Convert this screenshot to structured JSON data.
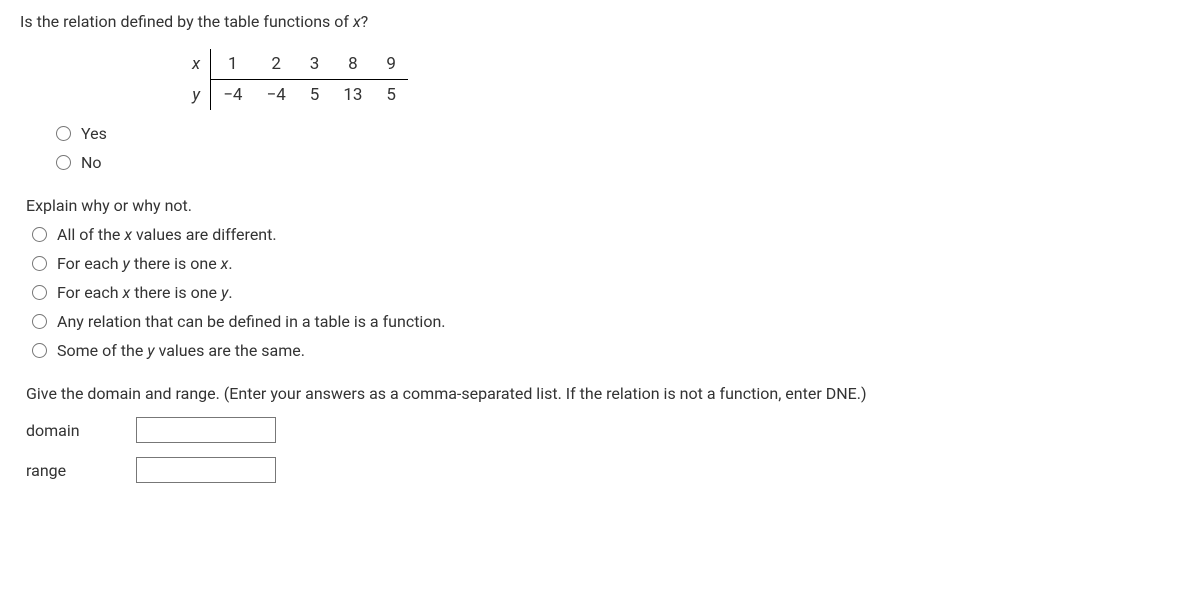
{
  "question": {
    "prefix": "Is the relation defined by the table functions of ",
    "var": "x",
    "suffix": "?"
  },
  "table": {
    "x_label": "x",
    "y_label": "y",
    "x_values": [
      "1",
      "2",
      "3",
      "8",
      "9"
    ],
    "y_values": [
      "−4",
      "−4",
      "5",
      "13",
      "5"
    ]
  },
  "options_yesno": {
    "yes": "Yes",
    "no": "No"
  },
  "explain_label": "Explain why or why not.",
  "options_explain": {
    "o1_pre": "All of the ",
    "o1_var": "x",
    "o1_post": " values are different.",
    "o2_pre": "For each ",
    "o2_var1": "y",
    "o2_mid": " there is one ",
    "o2_var2": "x",
    "o2_post": ".",
    "o3_pre": "For each ",
    "o3_var1": "x",
    "o3_mid": " there is one ",
    "o3_var2": "y",
    "o3_post": ".",
    "o4": "Any relation that can be defined in a table is a function.",
    "o5_pre": "Some of the ",
    "o5_var": "y",
    "o5_post": " values are the same."
  },
  "domain_range": {
    "label": "Give the domain and range. (Enter your answers as a comma-separated list. If the relation is not a function, enter DNE.)",
    "domain_label": "domain",
    "range_label": "range",
    "domain_value": "",
    "range_value": ""
  }
}
